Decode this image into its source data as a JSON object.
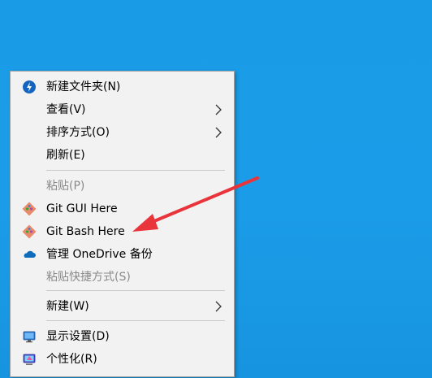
{
  "context_menu": {
    "items": [
      {
        "label": "新建文件夹(N)",
        "icon": "new-folder-icon",
        "enabled": true,
        "submenu": false
      },
      {
        "label": "查看(V)",
        "icon": "",
        "enabled": true,
        "submenu": true
      },
      {
        "label": "排序方式(O)",
        "icon": "",
        "enabled": true,
        "submenu": true
      },
      {
        "label": "刷新(E)",
        "icon": "",
        "enabled": true,
        "submenu": false
      },
      {
        "label": "粘贴(P)",
        "icon": "",
        "enabled": false,
        "submenu": false
      },
      {
        "label": "Git GUI Here",
        "icon": "git-icon",
        "enabled": true,
        "submenu": false
      },
      {
        "label": "Git Bash Here",
        "icon": "git-icon",
        "enabled": true,
        "submenu": false
      },
      {
        "label": "管理 OneDrive 备份",
        "icon": "onedrive-cloud-icon",
        "enabled": true,
        "submenu": false
      },
      {
        "label": "粘贴快捷方式(S)",
        "icon": "",
        "enabled": false,
        "submenu": false
      },
      {
        "label": "新建(W)",
        "icon": "",
        "enabled": true,
        "submenu": true
      },
      {
        "label": "显示设置(D)",
        "icon": "display-settings-icon",
        "enabled": true,
        "submenu": false
      },
      {
        "label": "个性化(R)",
        "icon": "personalize-icon",
        "enabled": true,
        "submenu": false
      }
    ]
  },
  "colors": {
    "desktop_bg": "#1a9be6",
    "menu_bg": "#f2f2f2",
    "disabled_text": "#8a8a8a",
    "annotation_arrow": "#e8343a"
  }
}
